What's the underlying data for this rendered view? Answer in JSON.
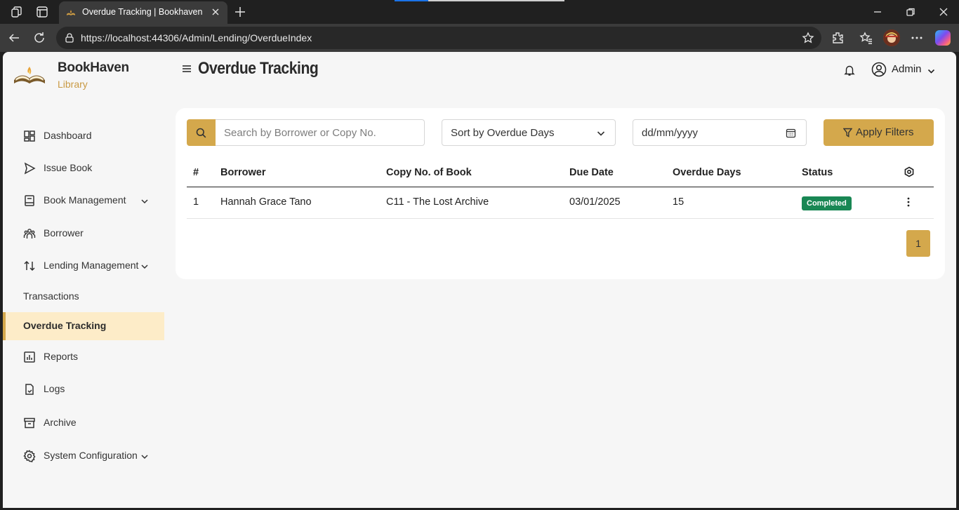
{
  "browser": {
    "tab_title": "Overdue Tracking | Bookhaven",
    "url": "https://localhost:44306/Admin/Lending/OverdueIndex"
  },
  "brand": {
    "name": "BookHaven",
    "subtitle": "Library"
  },
  "sidebar": {
    "items": [
      {
        "label": "Dashboard",
        "icon": "dashboard-icon"
      },
      {
        "label": "Issue Book",
        "icon": "send-icon"
      },
      {
        "label": "Book Management",
        "icon": "book-icon",
        "expandable": true
      },
      {
        "label": "Borrower",
        "icon": "users-icon"
      },
      {
        "label": "Lending Management",
        "icon": "arrows-updown-icon",
        "expandable": true
      },
      {
        "label": "Transactions",
        "sub": true
      },
      {
        "label": "Overdue Tracking",
        "sub": true,
        "active": true
      },
      {
        "label": "Reports",
        "icon": "chart-icon"
      },
      {
        "label": "Logs",
        "icon": "file-icon"
      },
      {
        "label": "Archive",
        "icon": "archive-icon"
      },
      {
        "label": "System Configuration",
        "icon": "gear-icon",
        "expandable": true
      }
    ]
  },
  "header": {
    "title": "Overdue Tracking",
    "user": "Admin"
  },
  "filters": {
    "search_placeholder": "Search by Borrower or Copy No.",
    "sort_value": "Sort by Overdue Days",
    "date_placeholder": "dd/mm/yyyy",
    "apply_label": "Apply Filters"
  },
  "table": {
    "columns": [
      "#",
      "Borrower",
      "Copy No. of Book",
      "Due Date",
      "Overdue Days",
      "Status"
    ],
    "rows": [
      {
        "num": "1",
        "borrower": "Hannah Grace Tano",
        "copy": "C11 - The Lost Archive",
        "due": "03/01/2025",
        "days": "15",
        "status": "Completed"
      }
    ]
  },
  "pagination": {
    "current": "1"
  },
  "colors": {
    "accent": "#d4a84c",
    "active_bg": "#fdecc8",
    "status_completed": "#198754",
    "brand_sub": "#c99a44"
  }
}
